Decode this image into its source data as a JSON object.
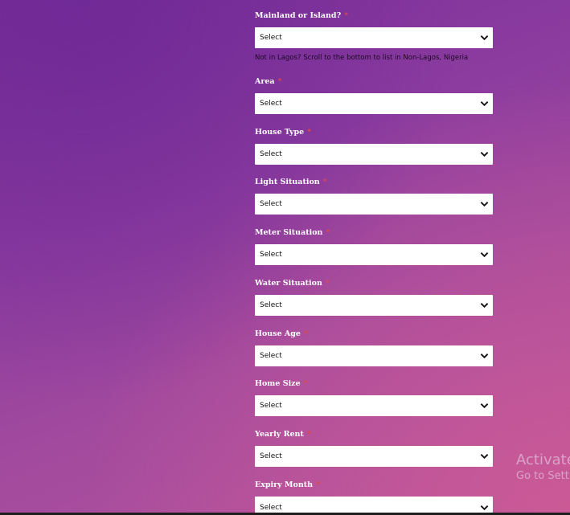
{
  "required_marker": "*",
  "select_placeholder": "Select",
  "location_hint": "Not in Lagos? Scroll to the bottom to list in Non-Lagos, Nigeria",
  "fields": [
    {
      "label": "Mainland or Island?",
      "value": "Select"
    },
    {
      "label": "Area",
      "value": "Select"
    },
    {
      "label": "House Type",
      "value": "Select"
    },
    {
      "label": "Light Situation",
      "value": "Select"
    },
    {
      "label": "Meter Situation",
      "value": "Select"
    },
    {
      "label": "Water Situation",
      "value": "Select"
    },
    {
      "label": "House Age",
      "value": "Select"
    },
    {
      "label": "Home Size",
      "value": "Select"
    },
    {
      "label": "Yearly Rent",
      "value": "Select"
    },
    {
      "label": "Expiry Month",
      "value": "Select"
    }
  ],
  "watermark": {
    "line1": "Activate",
    "line2": "Go to Sett"
  },
  "colors": {
    "required": "#e04848",
    "label": "#ffffff",
    "background_top": "#7a2f98",
    "background_bottom": "#b6549c"
  },
  "icons": {
    "dropdown": "chevron-down-icon"
  }
}
